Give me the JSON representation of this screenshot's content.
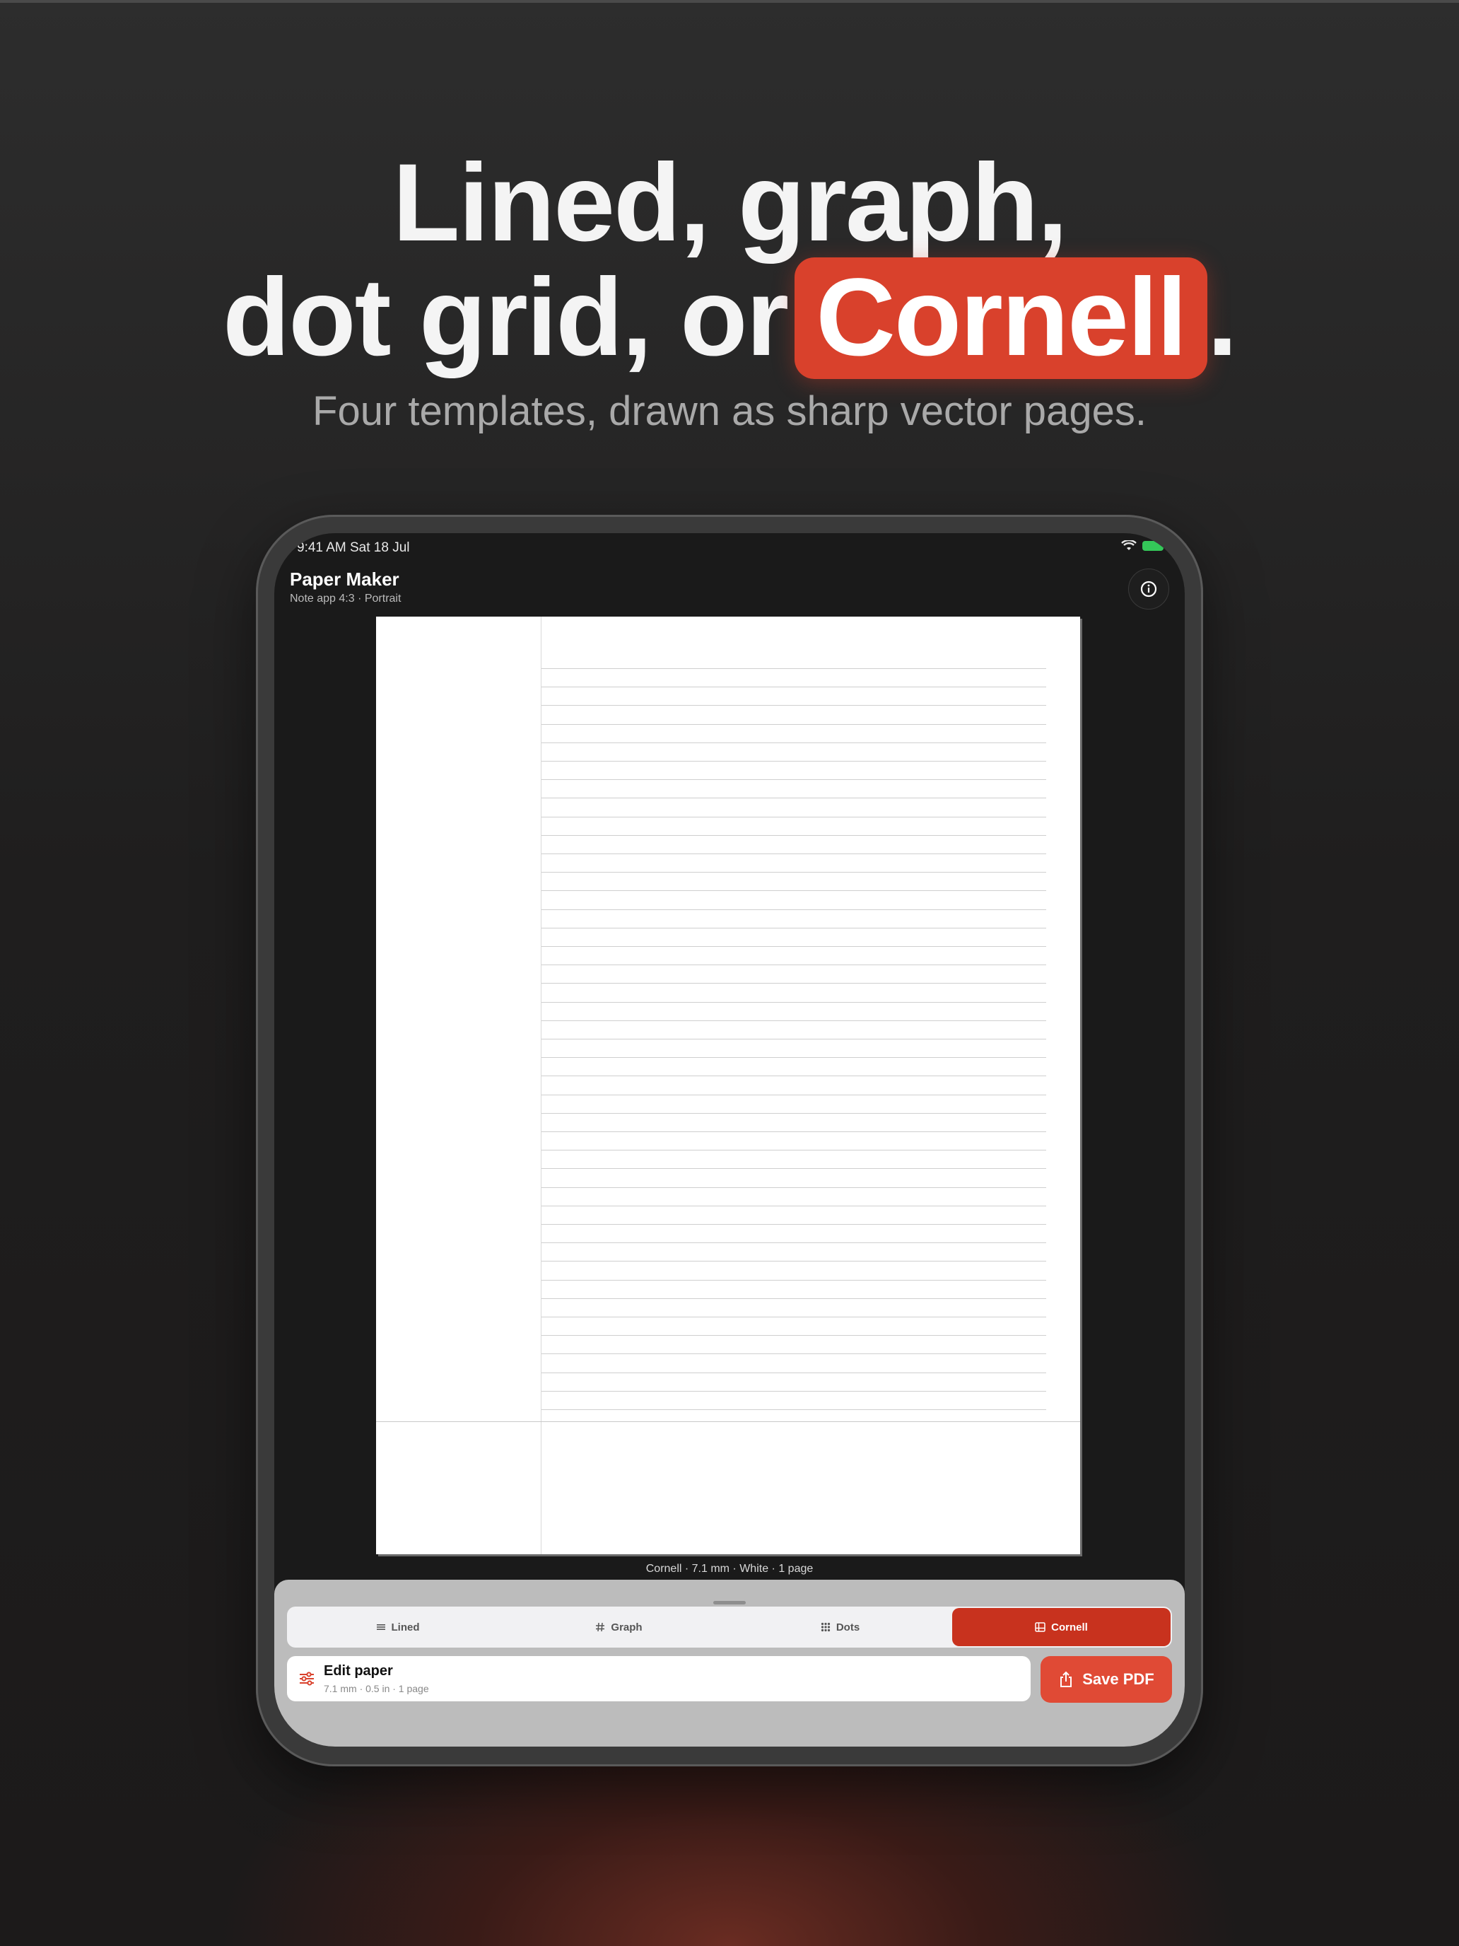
{
  "headline": {
    "line1": "Lined, graph,",
    "line2_prefix": "dot grid, or",
    "highlight": "Cornell",
    "line2_suffix": "."
  },
  "subhead": "Four templates, drawn as sharp vector pages.",
  "device": {
    "status": {
      "time": "9:41 AM   Sat 18 Jul"
    },
    "app": {
      "title": "Paper Maker",
      "subtitle": "Note app 4:3 · Portrait"
    },
    "preview": {
      "template": "Cornell",
      "ruled_line_count": 41,
      "caption": "Cornell · 7.1 mm · White · 1 page"
    },
    "tabs": [
      {
        "label": "Lined",
        "icon": "lines-icon",
        "active": false
      },
      {
        "label": "Graph",
        "icon": "hash-icon",
        "active": false
      },
      {
        "label": "Dots",
        "icon": "dots-grid-icon",
        "active": false
      },
      {
        "label": "Cornell",
        "icon": "cornell-layout-icon",
        "active": true
      }
    ],
    "edit": {
      "title": "Edit paper",
      "subtitle": "7.1 mm · 0.5 in · 1 page"
    },
    "save_label": "Save PDF"
  },
  "colors": {
    "accent": "#d9412c",
    "accent_dark": "#c8321e",
    "save": "#e04a35",
    "background": "#1f1e1e"
  }
}
